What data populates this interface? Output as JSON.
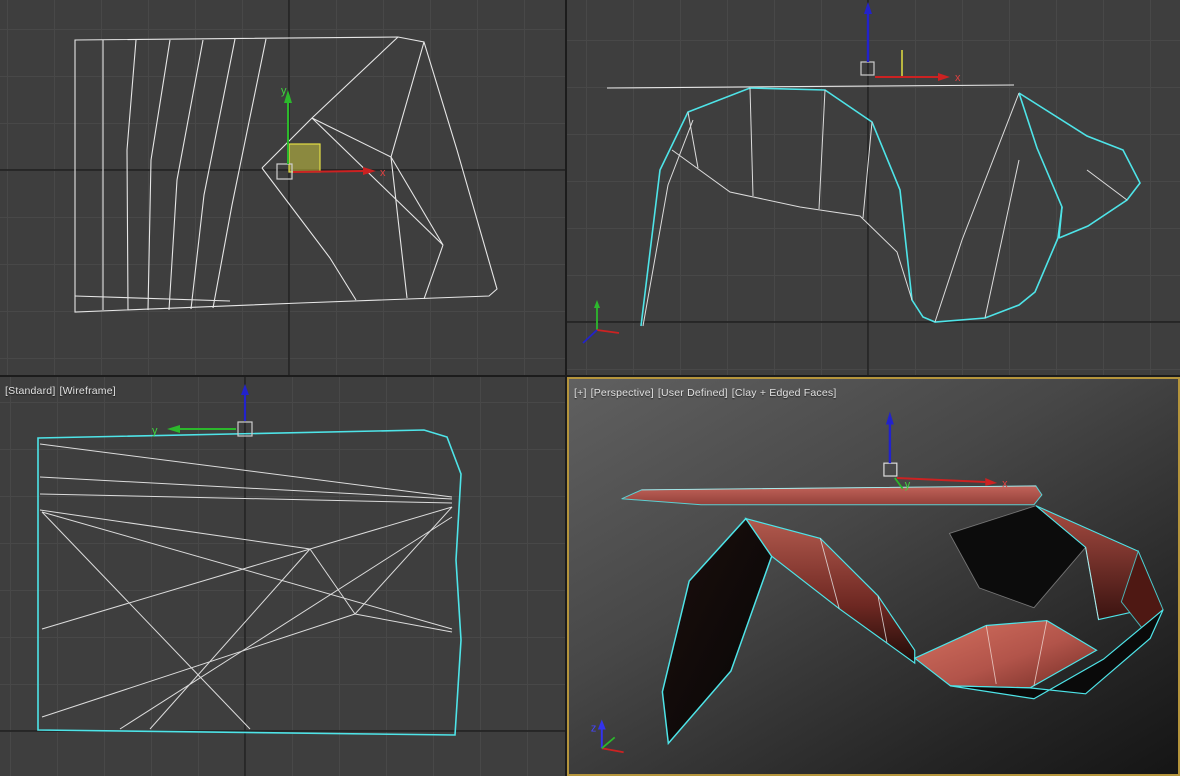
{
  "viewport_labels": {
    "bottom_left": [
      "[Standard]",
      "[Wireframe]"
    ],
    "bottom_right": [
      "[+]",
      "[Perspective]",
      "[User Defined]",
      "[Clay + Edged Faces]"
    ]
  },
  "axis_labels": {
    "x": "x",
    "y": "y",
    "z": "z"
  },
  "colors": {
    "viewport_background": "#3e3e3e",
    "grid_minor_line": "#484848",
    "grid_axis_line": "#1e1e1e",
    "wireframe_edge": "#e6e6e6",
    "selection_outline_cyan": "#4ee4e8",
    "active_viewport_border": "#b5953c",
    "clay_material": "#b05a50",
    "clay_highlight": "#d4705f",
    "backface_black": "#0b0b0b",
    "gizmo_x_red": "#cc2222",
    "gizmo_y_green": "#2cb82c",
    "gizmo_z_blue": "#2222cc",
    "plane_handle_yellow": "#d8d440"
  }
}
